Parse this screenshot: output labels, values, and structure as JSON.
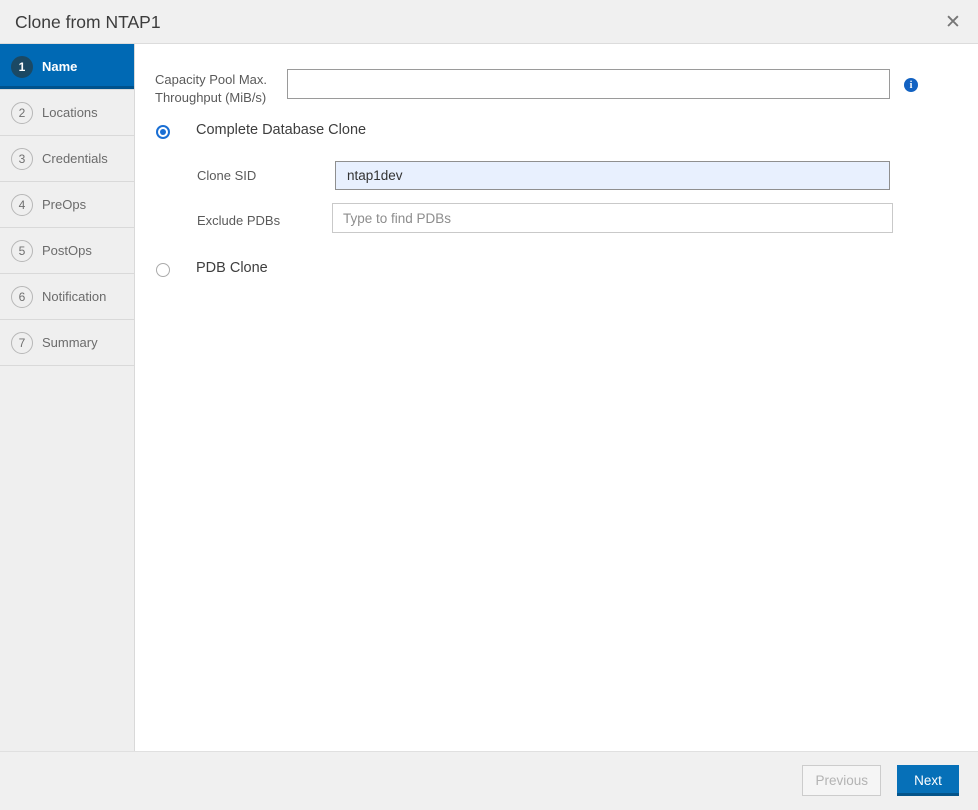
{
  "dialog": {
    "title": "Clone from NTAP1"
  },
  "icons": {
    "close": "✕",
    "info": "i"
  },
  "wizard": {
    "active_step": 1,
    "steps": [
      {
        "number": "1",
        "label": "Name"
      },
      {
        "number": "2",
        "label": "Locations"
      },
      {
        "number": "3",
        "label": "Credentials"
      },
      {
        "number": "4",
        "label": "PreOps"
      },
      {
        "number": "5",
        "label": "PostOps"
      },
      {
        "number": "6",
        "label": "Notification"
      },
      {
        "number": "7",
        "label": "Summary"
      }
    ]
  },
  "form": {
    "capacity_pool": {
      "label_line1": "Capacity Pool Max.",
      "label_line2": "Throughput (MiB/s)",
      "value": ""
    },
    "clone_type": {
      "complete_label": "Complete Database Clone",
      "pdb_label": "PDB Clone",
      "selected": "Complete Database Clone"
    },
    "clone_sid": {
      "label": "Clone SID",
      "value": "ntap1dev"
    },
    "exclude_pdbs": {
      "label": "Exclude PDBs",
      "value": "",
      "placeholder": "Type to find PDBs"
    }
  },
  "footer": {
    "previous_label": "Previous",
    "previous_enabled": false,
    "next_label": "Next"
  },
  "colors": {
    "accent_blue": "#0670b8",
    "active_step_bg": "#0069b4",
    "active_step_circle": "#1b4964",
    "radio_blue": "#1a6fd4",
    "info_icon_blue": "#1262c2",
    "autofill_bg": "#e8f0fe"
  }
}
